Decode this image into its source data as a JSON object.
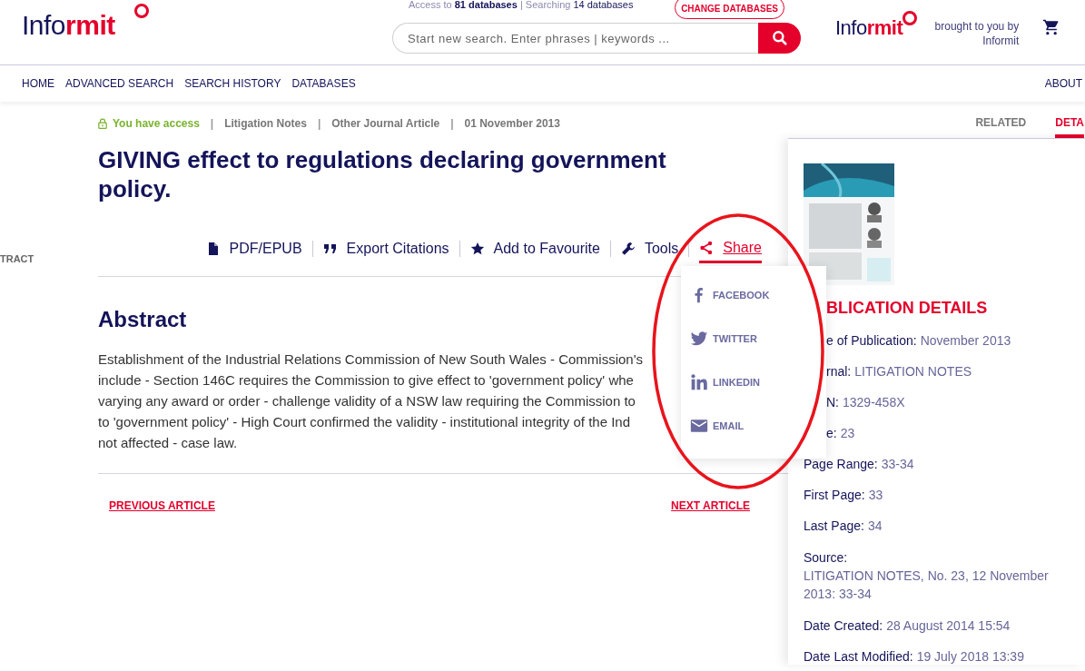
{
  "header": {
    "logo": [
      "Info",
      "rmit"
    ],
    "access": {
      "prefix": "Access to",
      "count": "81 databases",
      "separator": "|",
      "searching_prefix": "Searching",
      "searching_count": "14 databases"
    },
    "change_button": "CHANGE DATABASES",
    "search": {
      "placeholder": "Start new search. Enter phrases | keywords ..."
    },
    "partner_logo": [
      "Info",
      "rmit"
    ],
    "brought_by": "brought to you by Informit"
  },
  "nav": {
    "items": [
      "HOME",
      "ADVANCED SEARCH",
      "SEARCH HISTORY",
      "DATABASES"
    ],
    "about": "ABOUT"
  },
  "side_nav": {
    "label": "TRACT"
  },
  "article": {
    "access": "You have access",
    "separator": "|",
    "meta": [
      "Litigation Notes",
      "Other Journal Article",
      "01 November 2013"
    ],
    "title": "GIVING effect to regulations declaring government policy.",
    "toolbar": [
      {
        "kind": "pdf",
        "label": "PDF/EPUB",
        "selected": false
      },
      {
        "kind": "cite",
        "label": "Export Citations",
        "selected": false
      },
      {
        "kind": "favourite",
        "label": "Add to Favourite",
        "selected": false
      },
      {
        "kind": "tools",
        "label": "Tools",
        "selected": false
      },
      {
        "kind": "share",
        "label": "Share",
        "selected": true
      }
    ],
    "abstract_heading": "Abstract",
    "abstract_lines": [
      "Establishment of the Industrial Relations Commission of New South Wales - Commission's",
      "include - Section 146C requires the Commission to give effect to 'government policy' whe",
      "varying any award or order - challenge validity of a NSW law requiring the Commission to",
      "to 'government policy' - High Court confirmed the validity - institutional integrity of the Ind",
      "not affected - case law."
    ],
    "previous": "PREVIOUS ARTICLE",
    "next": "NEXT ARTICLE"
  },
  "share_menu": [
    {
      "kind": "facebook",
      "label": "FACEBOOK"
    },
    {
      "kind": "twitter",
      "label": "TWITTER"
    },
    {
      "kind": "linkedin",
      "label": "LINKEDIN"
    },
    {
      "kind": "email",
      "label": "EMAIL"
    }
  ],
  "panel": {
    "tabs": [
      {
        "label": "RELATED",
        "selected": false
      },
      {
        "label": "DETA",
        "selected": true
      }
    ],
    "heading": "BLICATION DETAILS",
    "details": [
      {
        "label": "e of Publication:",
        "value": "November 2013"
      },
      {
        "label": "rnal:",
        "value": "LITIGATION NOTES"
      },
      {
        "label": "N:",
        "value": "1329-458X"
      },
      {
        "label": "e:",
        "value": "23"
      },
      {
        "label": "Page Range:",
        "value": "33-34"
      },
      {
        "label": "First Page:",
        "value": "33"
      },
      {
        "label": "Last Page:",
        "value": "34"
      },
      {
        "label": "Source:",
        "value": "LITIGATION NOTES, No. 23, 12 November 2013: 33-34",
        "block": true
      },
      {
        "label": "Date Created:",
        "value": "28 August 2014 15:54"
      },
      {
        "label": "Date Last Modified:",
        "value": "19 July 2018 13:39"
      }
    ]
  }
}
